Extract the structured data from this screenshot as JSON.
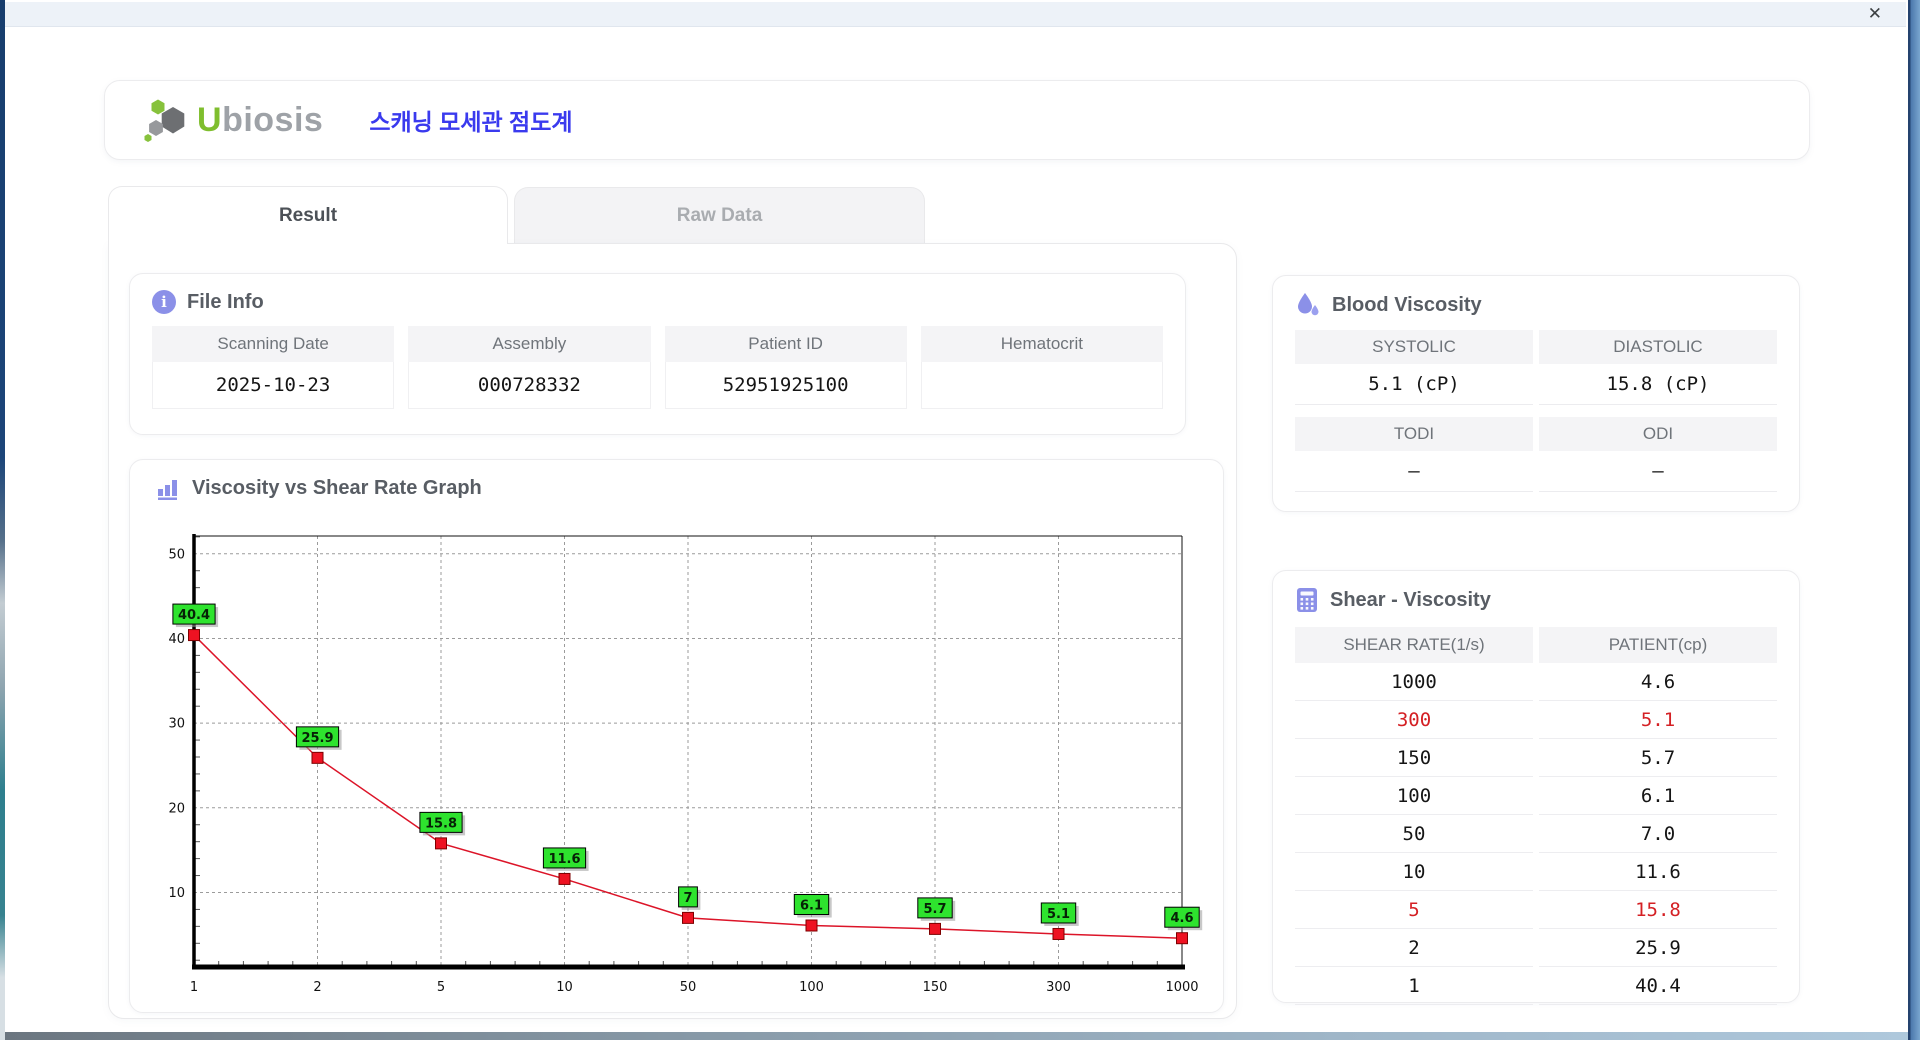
{
  "window": {
    "close_label": "✕"
  },
  "header": {
    "logo_u": "U",
    "logo_rest": "biosis",
    "app_title": "스캐닝 모세관 점도계"
  },
  "tabs": {
    "result": "Result",
    "raw": "Raw Data"
  },
  "icons": {
    "file_info": "info-circle",
    "blood_viscosity": "droplets",
    "graph": "bar-chart",
    "shear_table": "calculator",
    "close": "x"
  },
  "file_info": {
    "heading": "File Info",
    "fields": [
      {
        "label": "Scanning Date",
        "value": "2025-10-23"
      },
      {
        "label": "Assembly",
        "value": "000728332"
      },
      {
        "label": "Patient ID",
        "value": "52951925100"
      },
      {
        "label": "Hematocrit",
        "value": ""
      }
    ]
  },
  "blood_viscosity": {
    "heading": "Blood Viscosity",
    "groups": [
      [
        {
          "label": "SYSTOLIC",
          "value": "5.1 (cP)"
        },
        {
          "label": "DIASTOLIC",
          "value": "15.8 (cP)"
        }
      ],
      [
        {
          "label": "TODI",
          "value": "–"
        },
        {
          "label": "ODI",
          "value": "–"
        }
      ]
    ]
  },
  "graph": {
    "heading": "Viscosity vs Shear Rate Graph"
  },
  "chart_data": {
    "type": "line",
    "title": "Viscosity vs Shear Rate Graph",
    "x_scale": "categorical",
    "categories": [
      "1",
      "2",
      "5",
      "10",
      "50",
      "100",
      "150",
      "300",
      "1000"
    ],
    "values": [
      40.4,
      25.9,
      15.8,
      11.6,
      7,
      6.1,
      5.7,
      5.1,
      4.6
    ],
    "point_labels": [
      "40.4",
      "25.9",
      "15.8",
      "11.6",
      "7",
      "6.1",
      "5.7",
      "5.1",
      "4.6"
    ],
    "yticks": [
      10,
      20,
      30,
      40,
      50
    ],
    "ydomain": [
      1.2,
      52.1
    ],
    "grid": true,
    "legend": false,
    "line_color": "#dc1428",
    "marker_color": "#ee1222",
    "marker_shape": "square",
    "point_label_bg": "#2ee32e",
    "accent_color": "#8b90e8"
  },
  "shear_table": {
    "heading": "Shear - Viscosity",
    "columns": [
      "SHEAR RATE(1/s)",
      "PATIENT(cp)"
    ],
    "alert_color": "#d42024",
    "rows": [
      {
        "shear": "1000",
        "patient": "4.6",
        "alert": false
      },
      {
        "shear": "300",
        "patient": "5.1",
        "alert": true
      },
      {
        "shear": "150",
        "patient": "5.7",
        "alert": false
      },
      {
        "shear": "100",
        "patient": "6.1",
        "alert": false
      },
      {
        "shear": "50",
        "patient": "7.0",
        "alert": false
      },
      {
        "shear": "10",
        "patient": "11.6",
        "alert": false
      },
      {
        "shear": "5",
        "patient": "15.8",
        "alert": true
      },
      {
        "shear": "2",
        "patient": "25.9",
        "alert": false
      },
      {
        "shear": "1",
        "patient": "40.4",
        "alert": false
      }
    ]
  }
}
